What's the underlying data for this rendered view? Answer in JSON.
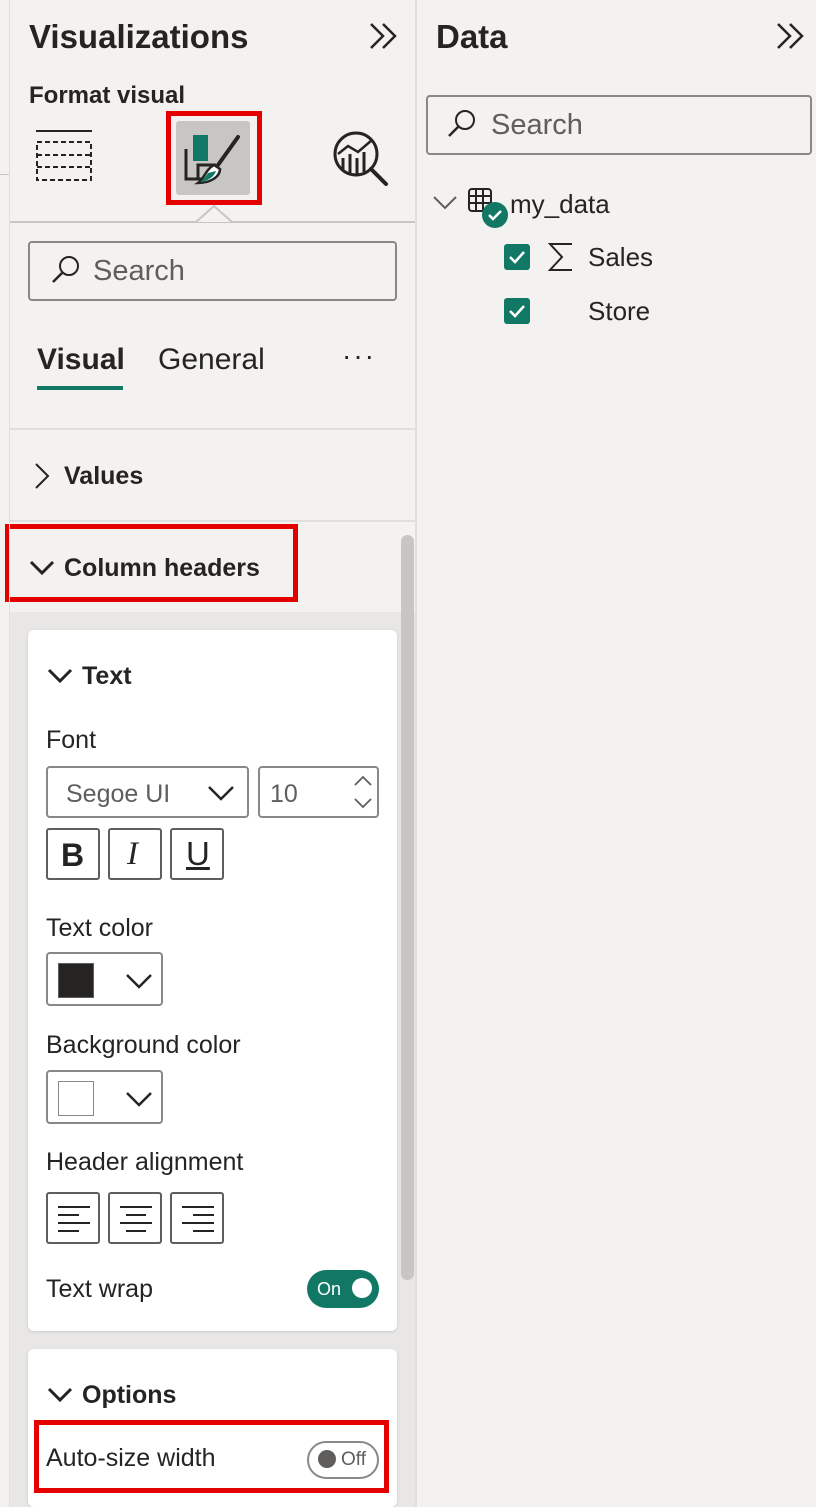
{
  "visualizations": {
    "title": "Visualizations",
    "collapse_icon": "double-chevron-right-icon",
    "subtitle": "Format visual",
    "toolbar_icons": [
      "build-visual-icon",
      "format-visual-icon",
      "analytics-icon"
    ],
    "search_placeholder": "Search",
    "tabs": [
      {
        "label": "Visual",
        "selected": true
      },
      {
        "label": "General",
        "selected": false
      }
    ],
    "more_label": "···",
    "sections": {
      "values": {
        "label": "Values",
        "expanded": false
      },
      "column_headers": {
        "label": "Column headers",
        "expanded": true
      }
    },
    "text_card": {
      "heading": "Text",
      "font_label": "Font",
      "font_family_value": "Segoe UI",
      "font_size_value": "10",
      "bold_label": "B",
      "italic_label": "I",
      "underline_label": "U",
      "text_color_label": "Text color",
      "text_color_value": "#252423",
      "background_color_label": "Background color",
      "background_color_value": "#ffffff",
      "header_alignment_label": "Header alignment",
      "text_wrap_label": "Text wrap",
      "text_wrap_state": "On"
    },
    "options_card": {
      "heading": "Options",
      "auto_size_label": "Auto-size width",
      "auto_size_state": "Off"
    }
  },
  "data_pane": {
    "title": "Data",
    "collapse_icon": "double-chevron-right-icon",
    "search_placeholder": "Search",
    "table": {
      "name": "my_data",
      "fields": [
        {
          "label": "Sales",
          "checked": true,
          "icon": "sigma-icon"
        },
        {
          "label": "Store",
          "checked": true,
          "icon": ""
        }
      ]
    }
  },
  "colors": {
    "accent": "#117865",
    "highlight": "#e50000"
  }
}
